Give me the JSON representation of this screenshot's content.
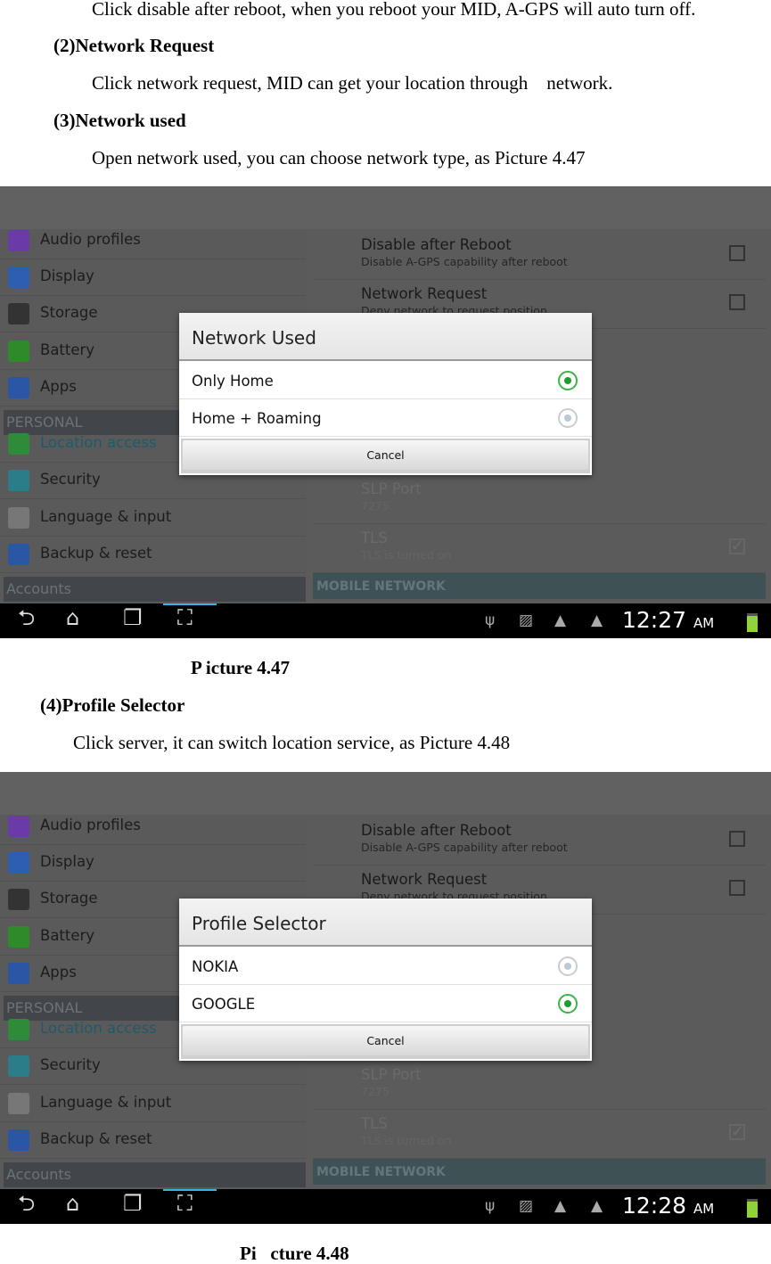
{
  "text": {
    "line1": "Click disable after reboot, when you reboot your MID, A-GPS will auto turn off.",
    "h2": "(2)Network Request",
    "line2": "Click network request, MID can get your location through    network.",
    "h3": "(3)Network used",
    "line3": "Open network used, you can choose network type, as Picture 4.47",
    "cap1": "P icture 4.47",
    "h4": "(4)Profile Selector",
    "line4": "Click server, it can switch location service, as Picture 4.48",
    "cap2": "Pi   cture 4.48"
  },
  "screenshots": [
    {
      "dialog": {
        "title": "Network Used",
        "options": [
          {
            "label": "Only Home",
            "selected": true
          },
          {
            "label": "Home + Roaming",
            "selected": false
          }
        ],
        "cancel": "Cancel"
      },
      "time": "12:27",
      "ampm": "AM"
    },
    {
      "dialog": {
        "title": "Profile Selector",
        "options": [
          {
            "label": "NOKIA",
            "selected": false
          },
          {
            "label": "GOOGLE",
            "selected": true
          }
        ],
        "cancel": "Cancel"
      },
      "time": "12:28",
      "ampm": "AM"
    }
  ],
  "settings": {
    "left": [
      {
        "label": "Audio profiles",
        "icon": "audio-profiles-icon",
        "color": "#6a3aa8"
      },
      {
        "label": "Display",
        "icon": "display-icon",
        "color": "#2d5fb0"
      },
      {
        "label": "Storage",
        "icon": "storage-icon",
        "color": "#333333"
      },
      {
        "label": "Battery",
        "icon": "battery-icon",
        "color": "#2f8a2a"
      },
      {
        "label": "Apps",
        "icon": "apps-icon",
        "color": "#2b56a6"
      },
      {
        "header": "PERSONAL"
      },
      {
        "label": "Location access",
        "icon": "location-icon",
        "color": "#2f8a3a",
        "accent": "#1f5a6a"
      },
      {
        "label": "Security",
        "icon": "security-icon",
        "color": "#2b7d8a"
      },
      {
        "label": "Language & input",
        "icon": "language-icon",
        "color": "#777777"
      },
      {
        "label": "Backup & reset",
        "icon": "backup-icon",
        "color": "#2b56a6"
      },
      {
        "header": "Accounts"
      }
    ],
    "right": [
      {
        "title": "Disable after Reboot",
        "subtitle": "Disable A-GPS capability after reboot",
        "checked": false
      },
      {
        "title": "Network Request",
        "subtitle": "Deny network to request position",
        "checked": false
      },
      {
        "title": "SLP Port",
        "subtitle": "7275",
        "disabled": true
      },
      {
        "title": "TLS",
        "subtitle": "TLS is turned on",
        "checked": true,
        "disabled": true
      }
    ],
    "section": "MOBILE NETWORK"
  }
}
